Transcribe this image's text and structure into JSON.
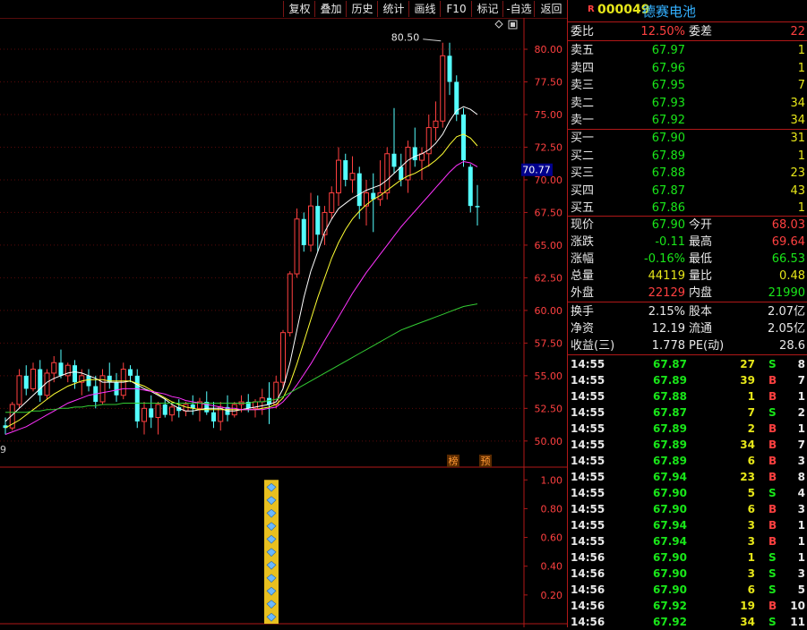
{
  "toolbar": [
    "复权",
    "叠加",
    "历史",
    "统计",
    "画线",
    "F10",
    "标记",
    "-自选",
    "返回"
  ],
  "stock": {
    "r_badge": "R",
    "code": "000049",
    "name": "德赛电池"
  },
  "quote": {
    "weibi_label": "委比",
    "weibi": "12.50%",
    "weicha_label": "委差",
    "weicha": "22",
    "asks": [
      {
        "label": "卖五",
        "price": "67.97",
        "vol": "1"
      },
      {
        "label": "卖四",
        "price": "67.96",
        "vol": "1"
      },
      {
        "label": "卖三",
        "price": "67.95",
        "vol": "7"
      },
      {
        "label": "卖二",
        "price": "67.93",
        "vol": "34"
      },
      {
        "label": "卖一",
        "price": "67.92",
        "vol": "34"
      }
    ],
    "bids": [
      {
        "label": "买一",
        "price": "67.90",
        "vol": "31"
      },
      {
        "label": "买二",
        "price": "67.89",
        "vol": "1"
      },
      {
        "label": "买三",
        "price": "67.88",
        "vol": "23"
      },
      {
        "label": "买四",
        "price": "67.87",
        "vol": "43"
      },
      {
        "label": "买五",
        "price": "67.86",
        "vol": "1"
      }
    ],
    "stats": [
      {
        "l1": "现价",
        "v1": "67.90",
        "c1": "g",
        "l2": "今开",
        "v2": "68.03",
        "c2": "r"
      },
      {
        "l1": "涨跌",
        "v1": "-0.11",
        "c1": "g",
        "l2": "最高",
        "v2": "69.64",
        "c2": "r"
      },
      {
        "l1": "涨幅",
        "v1": "-0.16%",
        "c1": "g",
        "l2": "最低",
        "v2": "66.53",
        "c2": "g"
      },
      {
        "l1": "总量",
        "v1": "44119",
        "c1": "y",
        "l2": "量比",
        "v2": "0.48",
        "c2": "y"
      },
      {
        "l1": "外盘",
        "v1": "22129",
        "c1": "r",
        "l2": "内盘",
        "v2": "21990",
        "c2": "g"
      }
    ],
    "fin": [
      {
        "l1": "换手",
        "v1": "2.15%",
        "l2": "股本",
        "v2": "2.07亿"
      },
      {
        "l1": "净资",
        "v1": "12.19",
        "l2": "流通",
        "v2": "2.05亿"
      },
      {
        "l1": "收益(三)",
        "v1": "1.778",
        "l2": "PE(动)",
        "v2": "28.6"
      }
    ],
    "ticks": [
      {
        "t": "14:55",
        "p": "67.87",
        "v": "27",
        "bs": "S",
        "n": "8"
      },
      {
        "t": "14:55",
        "p": "67.89",
        "v": "39",
        "bs": "B",
        "n": "7"
      },
      {
        "t": "14:55",
        "p": "67.88",
        "v": "1",
        "bs": "B",
        "n": "1"
      },
      {
        "t": "14:55",
        "p": "67.87",
        "v": "7",
        "bs": "S",
        "n": "2"
      },
      {
        "t": "14:55",
        "p": "67.89",
        "v": "2",
        "bs": "B",
        "n": "1"
      },
      {
        "t": "14:55",
        "p": "67.89",
        "v": "34",
        "bs": "B",
        "n": "7"
      },
      {
        "t": "14:55",
        "p": "67.89",
        "v": "6",
        "bs": "B",
        "n": "3"
      },
      {
        "t": "14:55",
        "p": "67.94",
        "v": "23",
        "bs": "B",
        "n": "8"
      },
      {
        "t": "14:55",
        "p": "67.90",
        "v": "5",
        "bs": "S",
        "n": "4"
      },
      {
        "t": "14:55",
        "p": "67.90",
        "v": "6",
        "bs": "B",
        "n": "3"
      },
      {
        "t": "14:55",
        "p": "67.94",
        "v": "3",
        "bs": "B",
        "n": "1"
      },
      {
        "t": "14:55",
        "p": "67.94",
        "v": "3",
        "bs": "B",
        "n": "1"
      },
      {
        "t": "14:56",
        "p": "67.90",
        "v": "1",
        "bs": "S",
        "n": "1"
      },
      {
        "t": "14:56",
        "p": "67.90",
        "v": "3",
        "bs": "S",
        "n": "3"
      },
      {
        "t": "14:56",
        "p": "67.90",
        "v": "6",
        "bs": "S",
        "n": "5"
      },
      {
        "t": "14:56",
        "p": "67.92",
        "v": "19",
        "bs": "B",
        "n": "10"
      },
      {
        "t": "14:56",
        "p": "67.92",
        "v": "34",
        "bs": "S",
        "n": "11"
      }
    ]
  },
  "chart_data": {
    "type": "candlestick",
    "main": {
      "y_ticks": [
        "80.00",
        "77.50",
        "75.00",
        "72.50",
        "70.00",
        "67.50",
        "65.00",
        "62.50",
        "60.00",
        "57.50",
        "55.00",
        "52.50",
        "50.00"
      ],
      "ylim": [
        48.0,
        82.4
      ],
      "current_price": "70.77",
      "high_marker": "80.50",
      "left_edge_label": "9",
      "tags": [
        "榜",
        "预"
      ],
      "candles": [
        [
          51.2,
          51.8,
          50.5,
          51.0
        ],
        [
          51.0,
          53.0,
          50.8,
          52.8
        ],
        [
          52.8,
          55.5,
          52.5,
          55.0
        ],
        [
          55.0,
          55.8,
          53.5,
          54.0
        ],
        [
          54.0,
          56.0,
          53.8,
          55.5
        ],
        [
          55.5,
          56.2,
          53.0,
          53.5
        ],
        [
          53.5,
          55.5,
          53.2,
          55.2
        ],
        [
          55.2,
          56.5,
          54.5,
          56.0
        ],
        [
          56.0,
          57.0,
          54.8,
          55.0
        ],
        [
          55.0,
          56.0,
          54.5,
          55.8
        ],
        [
          55.8,
          56.2,
          54.0,
          54.5
        ],
        [
          54.5,
          55.5,
          53.5,
          55.0
        ],
        [
          55.0,
          55.5,
          53.8,
          54.2
        ],
        [
          54.2,
          55.0,
          52.5,
          53.0
        ],
        [
          53.0,
          55.5,
          52.8,
          55.0
        ],
        [
          55.0,
          56.0,
          54.0,
          54.5
        ],
        [
          54.5,
          55.2,
          53.0,
          53.5
        ],
        [
          53.5,
          56.0,
          53.2,
          55.5
        ],
        [
          55.5,
          55.8,
          54.5,
          55.0
        ],
        [
          55.0,
          55.5,
          51.0,
          51.5
        ],
        [
          51.5,
          53.0,
          50.5,
          52.5
        ],
        [
          52.5,
          53.5,
          51.0,
          51.8
        ],
        [
          51.8,
          53.0,
          50.5,
          52.8
        ],
        [
          52.8,
          53.2,
          51.8,
          52.0
        ],
        [
          52.0,
          53.0,
          51.5,
          52.6
        ],
        [
          52.6,
          53.2,
          51.8,
          52.3
        ],
        [
          52.3,
          53.0,
          51.9,
          52.8
        ],
        [
          52.8,
          53.5,
          52.0,
          52.5
        ],
        [
          52.5,
          53.3,
          51.5,
          53.0
        ],
        [
          53.0,
          53.8,
          52.0,
          52.2
        ],
        [
          52.2,
          53.0,
          51.0,
          51.5
        ],
        [
          51.5,
          53.0,
          50.8,
          52.6
        ],
        [
          52.6,
          53.5,
          51.5,
          52.0
        ],
        [
          52.0,
          53.0,
          51.8,
          52.8
        ],
        [
          52.8,
          53.5,
          52.2,
          53.0
        ],
        [
          53.0,
          53.6,
          52.2,
          52.5
        ],
        [
          52.5,
          53.2,
          51.8,
          53.0
        ],
        [
          53.0,
          54.0,
          52.0,
          53.3
        ],
        [
          53.3,
          54.5,
          51.3,
          52.8
        ],
        [
          52.8,
          55.0,
          52.5,
          54.5
        ],
        [
          54.5,
          58.5,
          54.0,
          58.3
        ],
        [
          58.3,
          63.0,
          58.0,
          62.8
        ],
        [
          62.8,
          67.8,
          62.5,
          67.0
        ],
        [
          67.0,
          67.5,
          64.5,
          65.0
        ],
        [
          65.0,
          69.0,
          64.5,
          68.0
        ],
        [
          68.0,
          68.8,
          64.5,
          65.8
        ],
        [
          65.8,
          68.0,
          65.0,
          67.5
        ],
        [
          67.5,
          69.5,
          67.0,
          69.0
        ],
        [
          69.0,
          72.5,
          68.0,
          71.5
        ],
        [
          71.5,
          72.0,
          69.5,
          70.0
        ],
        [
          70.0,
          71.8,
          69.0,
          70.5
        ],
        [
          70.5,
          71.0,
          67.0,
          68.0
        ],
        [
          68.0,
          70.0,
          66.5,
          69.0
        ],
        [
          69.0,
          70.5,
          66.0,
          68.5
        ],
        [
          68.5,
          71.5,
          68.0,
          69.0
        ],
        [
          69.0,
          72.5,
          68.5,
          72.0
        ],
        [
          72.0,
          75.5,
          70.5,
          71.0
        ],
        [
          71.0,
          72.0,
          69.5,
          70.0
        ],
        [
          70.0,
          73.0,
          69.0,
          72.5
        ],
        [
          72.5,
          74.0,
          71.0,
          71.5
        ],
        [
          71.5,
          72.5,
          70.0,
          72.0
        ],
        [
          72.0,
          75.0,
          71.0,
          74.0
        ],
        [
          74.0,
          76.0,
          73.0,
          74.5
        ],
        [
          74.5,
          80.5,
          74.0,
          79.5
        ],
        [
          79.5,
          80.5,
          76.5,
          77.5
        ],
        [
          77.5,
          78.0,
          74.5,
          75.0
        ],
        [
          75.0,
          75.5,
          71.0,
          71.5
        ],
        [
          71.0,
          71.2,
          67.5,
          68.0
        ],
        [
          68.0,
          69.6,
          66.5,
          67.9
        ]
      ],
      "ma_lines": [
        {
          "color": "#ffffff",
          "values": [
            51.5,
            52,
            52.5,
            53,
            53.5,
            54,
            54.5,
            54.8,
            55,
            55.2,
            55.3,
            55.2,
            55,
            54.8,
            54.5,
            54.5,
            54.5,
            54.5,
            54.6,
            54.3,
            54,
            53.8,
            53.5,
            53.2,
            52.8,
            52.5,
            52.3,
            52.3,
            52.4,
            52.5,
            52.5,
            52.5,
            52.3,
            52.3,
            52.4,
            52.5,
            52.6,
            52.7,
            52.8,
            53,
            54,
            56,
            58.5,
            61,
            63,
            64.5,
            66,
            67,
            67.8,
            68.2,
            68.6,
            68.9,
            69.2,
            69.4,
            69.6,
            70,
            70.5,
            71,
            71.5,
            71.8,
            72,
            72.3,
            72.8,
            73.5,
            74.5,
            75.3,
            75.6,
            75.4,
            75.0
          ]
        },
        {
          "color": "#ffff33",
          "values": [
            51,
            51.3,
            51.6,
            52,
            52.4,
            52.8,
            53.2,
            53.6,
            53.9,
            54.2,
            54.4,
            54.6,
            54.7,
            54.7,
            54.7,
            54.6,
            54.6,
            54.6,
            54.6,
            54.4,
            54.2,
            53.9,
            53.6,
            53.3,
            53,
            52.8,
            52.6,
            52.5,
            52.4,
            52.4,
            52.4,
            52.4,
            52.4,
            52.4,
            52.4,
            52.4,
            52.4,
            52.5,
            52.6,
            52.8,
            53.3,
            54.4,
            55.9,
            57.6,
            59.3,
            61,
            62.5,
            64,
            65.2,
            66.2,
            67,
            67.6,
            68.1,
            68.5,
            68.8,
            69.2,
            69.6,
            70,
            70.3,
            70.5,
            70.8,
            71.1,
            71.5,
            72,
            72.7,
            73.3,
            73.5,
            73.2,
            72.6
          ]
        },
        {
          "color": "#ff33ff",
          "values": [
            50.5,
            50.7,
            50.9,
            51.1,
            51.4,
            51.7,
            52,
            52.3,
            52.6,
            52.9,
            53.1,
            53.3,
            53.5,
            53.6,
            53.7,
            53.8,
            53.9,
            54,
            54,
            54,
            53.9,
            53.8,
            53.7,
            53.6,
            53.4,
            53.3,
            53.1,
            53,
            52.9,
            52.8,
            52.7,
            52.6,
            52.5,
            52.5,
            52.4,
            52.4,
            52.4,
            52.4,
            52.5,
            52.6,
            53,
            53.6,
            54.3,
            55.1,
            55.9,
            56.8,
            57.7,
            58.6,
            59.5,
            60.4,
            61.3,
            62.1,
            62.9,
            63.6,
            64.3,
            65,
            65.7,
            66.4,
            67,
            67.6,
            68.2,
            68.8,
            69.4,
            70,
            70.6,
            71.1,
            71.4,
            71.3,
            71.0
          ]
        },
        {
          "color": "#33cc33",
          "values": [
            52.2,
            52.2,
            52.2,
            52.2,
            52.3,
            52.3,
            52.4,
            52.4,
            52.5,
            52.5,
            52.6,
            52.6,
            52.7,
            52.7,
            52.8,
            52.8,
            52.8,
            52.9,
            52.9,
            52.9,
            52.9,
            52.9,
            52.9,
            52.9,
            52.9,
            52.9,
            52.9,
            52.9,
            52.9,
            52.9,
            52.9,
            52.9,
            52.9,
            52.9,
            52.9,
            52.9,
            53,
            53,
            53.1,
            53.2,
            53.4,
            53.7,
            54,
            54.3,
            54.6,
            54.9,
            55.2,
            55.5,
            55.8,
            56.1,
            56.4,
            56.7,
            57,
            57.3,
            57.6,
            57.9,
            58.2,
            58.5,
            58.7,
            58.9,
            59.1,
            59.3,
            59.5,
            59.7,
            59.9,
            60.1,
            60.3,
            60.4,
            60.5
          ]
        }
      ]
    },
    "indicator": {
      "y_ticks": [
        "1.00",
        "0.80",
        "0.60",
        "0.40",
        "0.20"
      ],
      "ylim": [
        0,
        1.07
      ],
      "bar_value": 1.0,
      "bar_index": 39
    }
  }
}
